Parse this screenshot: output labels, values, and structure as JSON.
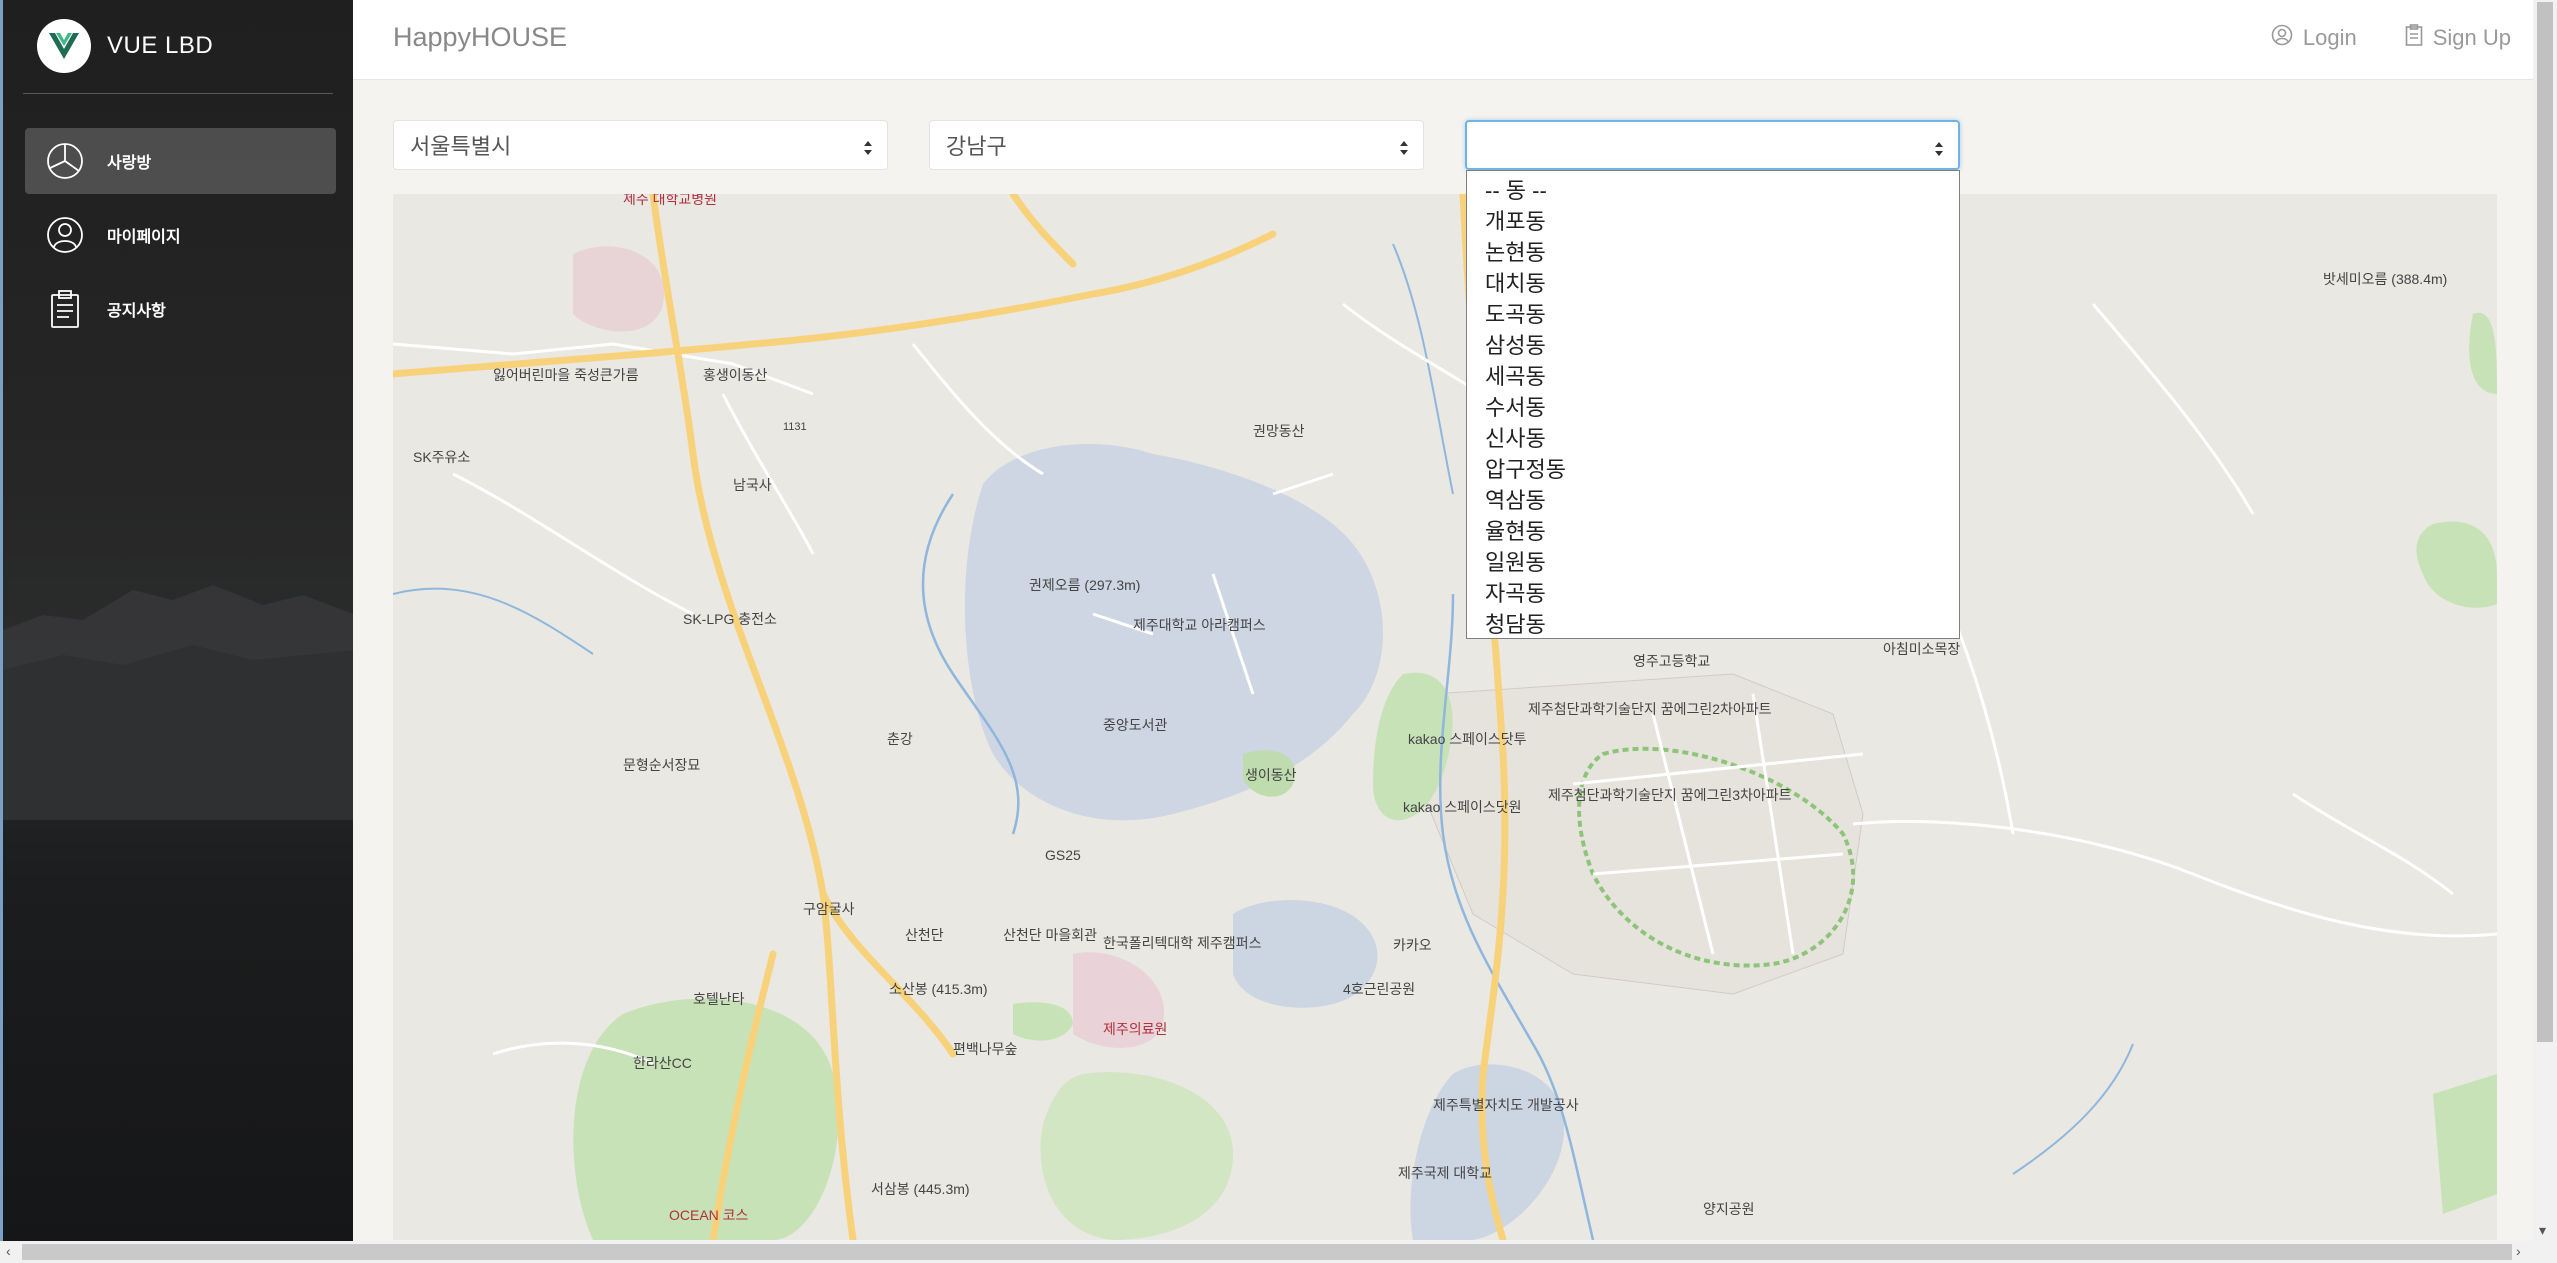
{
  "sidebar": {
    "brand_logo": "V",
    "brand": "VUE LBD",
    "items": [
      {
        "label": "사랑방",
        "icon": "pie-chart-icon",
        "active": true
      },
      {
        "label": "마이페이지",
        "icon": "user-icon",
        "active": false
      },
      {
        "label": "공지사항",
        "icon": "clipboard-icon",
        "active": false
      }
    ]
  },
  "navbar": {
    "brand": "HappyHOUSE",
    "login": "Login",
    "signup": "Sign Up"
  },
  "selects": {
    "city": "서울특별시",
    "gu": "강남구",
    "dong": ""
  },
  "dropdown": {
    "options": [
      "-- 동 --",
      "개포동",
      "논현동",
      "대치동",
      "도곡동",
      "삼성동",
      "세곡동",
      "수서동",
      "신사동",
      "압구정동",
      "역삼동",
      "율현동",
      "일원동",
      "자곡동",
      "청담동"
    ]
  },
  "map": {
    "labels": [
      "제주 대학교병원",
      "잃어버린마을 죽성큰가름",
      "홍생이동산",
      "1131",
      "SK주유소",
      "남국사",
      "권망동산",
      "권제오름 (297.3m)",
      "제주대학교 아라캠퍼스",
      "SK-LPG 충전소",
      "중앙도서관",
      "생이동산",
      "춘강",
      "문형순서장묘",
      "GS25",
      "구암굴사",
      "산천단",
      "산천단 마을회관",
      "한국폴리텍대학 제주캠퍼스",
      "소산봉 (415.3m)",
      "호텔난타",
      "한라산CC",
      "편백나무숲",
      "제주의료원",
      "4호근린공원",
      "카카오",
      "kakao 스페이스닷투",
      "kakao 스페이스닷원",
      "제주첨단과학기술단지 꿈에그린2차아파트",
      "제주첨단과학기술단지 꿈에그린3차아파트",
      "영주고등학교",
      "아침미소목장",
      "밧세미오름 (388.4m)",
      "제주특별자치도 개발공사",
      "제주국제 대학교",
      "서삼봉 (445.3m)",
      "OCEAN 코스",
      "양지공원"
    ],
    "colors": {
      "land": "#e9e8e3",
      "campus": "#ced6e3",
      "green": "#c8e2b8",
      "road_main": "#f7d27a",
      "water": "#8fb6dc"
    }
  }
}
